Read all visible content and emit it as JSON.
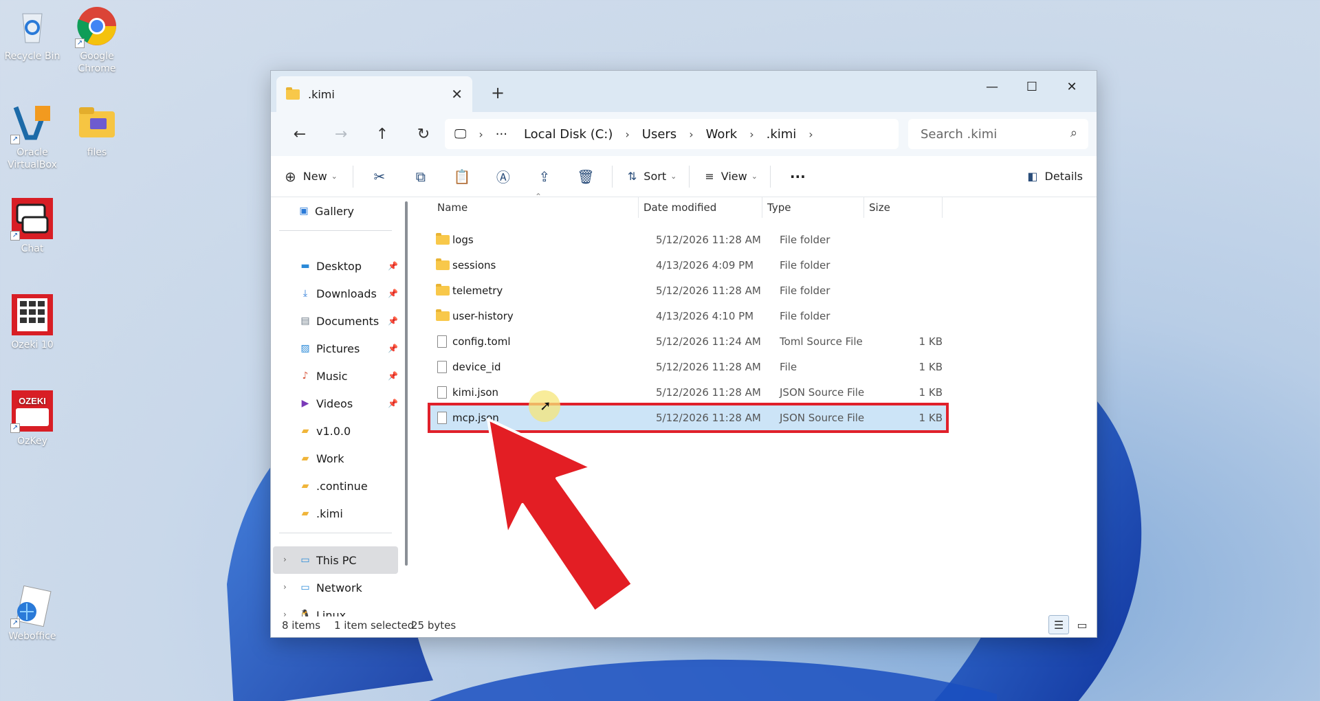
{
  "desktop": {
    "icons": [
      {
        "label": "Recycle Bin",
        "icon": "recycle-bin-icon"
      },
      {
        "label": "Google Chrome",
        "icon": "chrome-icon"
      },
      {
        "label": "Oracle VirtualBox",
        "icon": "virtualbox-icon"
      },
      {
        "label": "files",
        "icon": "folder-icon"
      },
      {
        "label": "Chat",
        "icon": "chat-icon"
      },
      {
        "label": "Ozeki 10",
        "icon": "ozeki-icon"
      },
      {
        "label": "OzKey",
        "icon": "ozkey-icon"
      },
      {
        "label": "Weboffice",
        "icon": "weboffice-icon"
      }
    ]
  },
  "window": {
    "tab_title": ".kimi",
    "new_tab": "+",
    "controls": {
      "minimize": "—",
      "maximize": "☐",
      "close": "✕"
    }
  },
  "navbar": {
    "breadcrumb": [
      "Local Disk (C:)",
      "Users",
      "Work",
      ".kimi"
    ],
    "more": "···",
    "search_placeholder": "Search .kimi"
  },
  "toolbar": {
    "new_label": "New",
    "sort_label": "Sort",
    "view_label": "View",
    "more": "···",
    "details_label": "Details"
  },
  "sidebar": {
    "gallery": "Gallery",
    "quick_access": [
      {
        "label": "Desktop",
        "icon": "desktop-icon",
        "pinned": true
      },
      {
        "label": "Downloads",
        "icon": "download-icon",
        "pinned": true
      },
      {
        "label": "Documents",
        "icon": "documents-icon",
        "pinned": true
      },
      {
        "label": "Pictures",
        "icon": "pictures-icon",
        "pinned": true
      },
      {
        "label": "Music",
        "icon": "music-icon",
        "pinned": true
      },
      {
        "label": "Videos",
        "icon": "videos-icon",
        "pinned": true
      },
      {
        "label": "v1.0.0",
        "icon": "folder-icon",
        "pinned": false
      },
      {
        "label": "Work",
        "icon": "folder-icon",
        "pinned": false
      },
      {
        "label": ".continue",
        "icon": "folder-icon",
        "pinned": false
      },
      {
        "label": ".kimi",
        "icon": "folder-icon",
        "pinned": false
      }
    ],
    "this_pc": "This PC",
    "network": "Network",
    "linux": "Linux"
  },
  "columns": {
    "name": "Name",
    "date": "Date modified",
    "type": "Type",
    "size": "Size"
  },
  "files": [
    {
      "name": "logs",
      "date": "5/12/2026 11:28 AM",
      "type": "File folder",
      "size": "",
      "kind": "folder"
    },
    {
      "name": "sessions",
      "date": "4/13/2026 4:09 PM",
      "type": "File folder",
      "size": "",
      "kind": "folder"
    },
    {
      "name": "telemetry",
      "date": "5/12/2026 11:28 AM",
      "type": "File folder",
      "size": "",
      "kind": "folder"
    },
    {
      "name": "user-history",
      "date": "4/13/2026 4:10 PM",
      "type": "File folder",
      "size": "",
      "kind": "folder"
    },
    {
      "name": "config.toml",
      "date": "5/12/2026 11:24 AM",
      "type": "Toml Source File",
      "size": "1 KB",
      "kind": "file"
    },
    {
      "name": "device_id",
      "date": "5/12/2026 11:28 AM",
      "type": "File",
      "size": "1 KB",
      "kind": "file"
    },
    {
      "name": "kimi.json",
      "date": "5/12/2026 11:28 AM",
      "type": "JSON Source File",
      "size": "1 KB",
      "kind": "file"
    },
    {
      "name": "mcp.json",
      "date": "5/12/2026 11:28 AM",
      "type": "JSON Source File",
      "size": "1 KB",
      "kind": "file",
      "selected": true
    }
  ],
  "status": {
    "items": "8 items",
    "selected": "1 item selected",
    "size": "25 bytes"
  },
  "colors": {
    "highlight": "#e0202a",
    "selection": "#cce4f7",
    "folder": "#f8c84a"
  }
}
